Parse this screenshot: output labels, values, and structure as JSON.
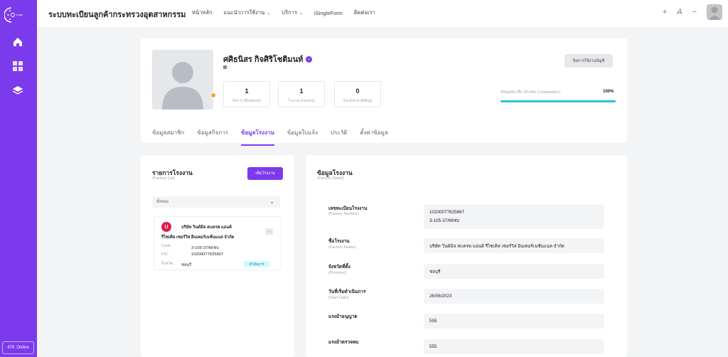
{
  "sidebar": {
    "logo_text": "Logo",
    "online_count": "476",
    "online_label": "Online"
  },
  "header": {
    "app_title": "ระบบทะเบียนลูกค้ากระทรวงอุตสาหกรรม",
    "nav": [
      {
        "label": "หน้าหลัก",
        "dropdown": false
      },
      {
        "label": "แนะนำการใช้งาน",
        "dropdown": true
      },
      {
        "label": "บริการ",
        "dropdown": true
      },
      {
        "label": "iSingleForm",
        "dropdown": false
      },
      {
        "label": "ติดต่อเรา",
        "dropdown": false
      }
    ],
    "zoom_in": "+",
    "font_size": "A",
    "zoom_out": "−"
  },
  "profile": {
    "name": "ศศิธนิสร กิจศิริโชติมนท์",
    "sub_text": "-",
    "stats": [
      {
        "value": "1",
        "label": "กิจการ (Business)"
      },
      {
        "value": "1",
        "label": "โรงงาน (Factory)"
      },
      {
        "value": "0",
        "label": "ใบแจ้งจ่าย (Billing)"
      }
    ],
    "close_account_label": "ปิดการใช้งานบัญชี",
    "completion_label": "ข้อมูลสมาชิก (Profile Complestion)",
    "completion_value": "100%",
    "completion_fraction": 1.0,
    "tabs": [
      "ข้อมูลสมาชิก",
      "ข้อมูลกิจการ",
      "ข้อมูลโรงงาน",
      "ข้อมูลใบแจ้ง",
      "ประวัติ",
      "ตั้งค่าข้อมูล"
    ],
    "active_tab": 2
  },
  "factory_list": {
    "title": "รายการโรงงาน",
    "subtitle": "(Factory List)",
    "add_label": "เพิ่มโรงงาน",
    "filter_value": "ทั้งหมด",
    "item": {
      "avatar_letter": "U",
      "name_line1": "บริษัท วินด์มิล สเเครพ แอนด์",
      "name_line2": "รีไซเคิล เซอร์วิส อินเตอร์เนชั่นแนล จำกัด",
      "more": "···",
      "code_label": "Code :",
      "code_value": "3-105-37/66ชบ",
      "fid_label": "FID :",
      "fid_value": "10200077625667",
      "province_label": "จังหวัด :",
      "province_value": "ชลบุรี",
      "status": "ดำเนินการ"
    }
  },
  "factory_detail": {
    "title": "ข้อมูลโรงงาน",
    "subtitle": "(Factory Detail)",
    "fields": [
      {
        "label": "เลขทะเบียนโรงงาน",
        "sublabel": "(Factory Number)",
        "value1": "10200077625667",
        "value2": "3-105-37/66ชบ"
      },
      {
        "label": "ชื่อโรงงาน",
        "sublabel": "(Factory Name)",
        "value1": "บริษัท วินด์มิล สเเครพ แอนด์ รีไซเคิล เซอร์วิส อินเตอร์เนชั่นแนล จำกัด"
      },
      {
        "label": "จังหวัดที่ตั้ง",
        "sublabel": "(Province)",
        "value1": "ชลบุรี"
      },
      {
        "label": "วันที่เริ่มดำเนินการ",
        "sublabel": "(Start Date)",
        "value1": "26/06/2023"
      },
      {
        "label": "แรงม้าอนุญาต",
        "sublabel": "",
        "value1": "555"
      },
      {
        "label": "แรงม้าตรวจพบ",
        "sublabel": "",
        "value1": "555"
      }
    ]
  },
  "colors": {
    "primary": "#7c3aed",
    "accent": "#22c7d0",
    "status_dot": "#f5a524"
  }
}
